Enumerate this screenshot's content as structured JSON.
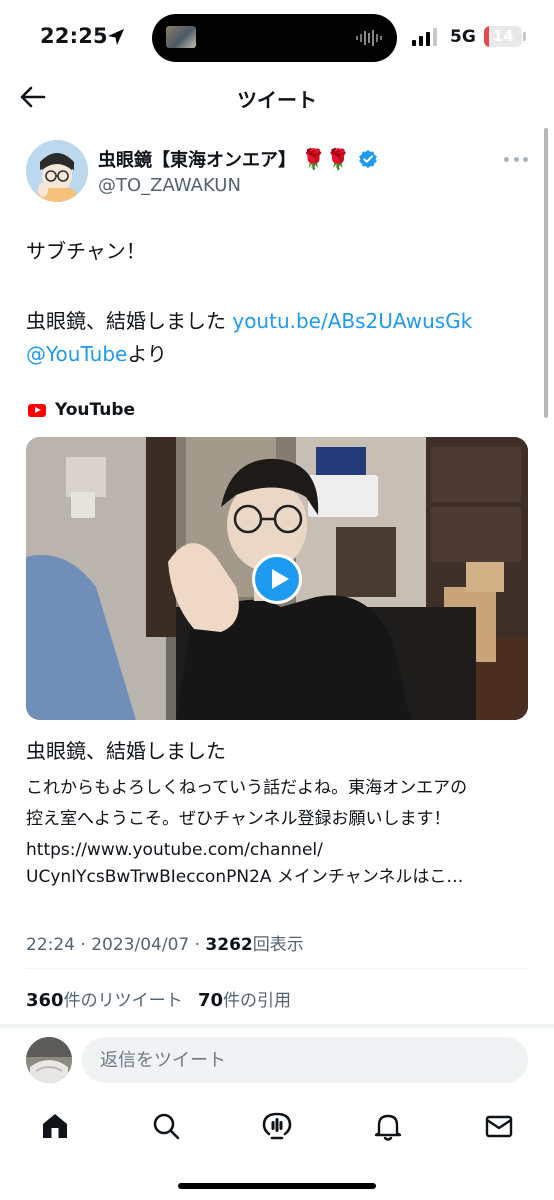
{
  "status_bar": {
    "time": "22:25",
    "network": "5G",
    "battery": "14",
    "battery_level": 0.14,
    "colors": {
      "battery_low": "#e5484d"
    }
  },
  "header": {
    "title": "ツイート"
  },
  "author": {
    "display_name": "虫眼鏡【東海オンエア】",
    "name_emoji": "🌹🌹",
    "handle": "@TO_ZAWAKUN",
    "verified": true
  },
  "tweet": {
    "line1": "サブチャン！",
    "line2_text": "虫眼鏡、結婚しました ",
    "line2_link": "youtu.be/ABs2UAwusGk",
    "line3_mention": "@YouTube",
    "line3_text": "より"
  },
  "card": {
    "source": "YouTube",
    "title": "虫眼鏡、結婚しました",
    "description_lines": [
      "これからもよろしくねっていう話だよね。東海オンエアの",
      "控え室へようこそ。ぜひチャンネル登録お願いします！",
      "https://www.youtube.com/channel/",
      "UCynIYcsBwTrwBIecconPN2A メインチャンネルはこ…"
    ]
  },
  "meta": {
    "time": "22:24",
    "sep1": " · ",
    "date": "2023/04/07",
    "sep2": " · ",
    "views": "3262",
    "views_label": "回表示"
  },
  "stats": {
    "retweets": "360",
    "retweets_label": "件のリツイート",
    "quotes": "70",
    "quotes_label": "件の引用"
  },
  "reply": {
    "placeholder": "返信をツイート"
  },
  "nav": {
    "items": [
      "home-icon",
      "search-icon",
      "spaces-icon",
      "notifications-icon",
      "messages-icon"
    ]
  },
  "colors": {
    "accent": "#1d9bf0",
    "youtube_red": "#ff0000",
    "text": "#0f1419",
    "secondary": "#536471"
  }
}
